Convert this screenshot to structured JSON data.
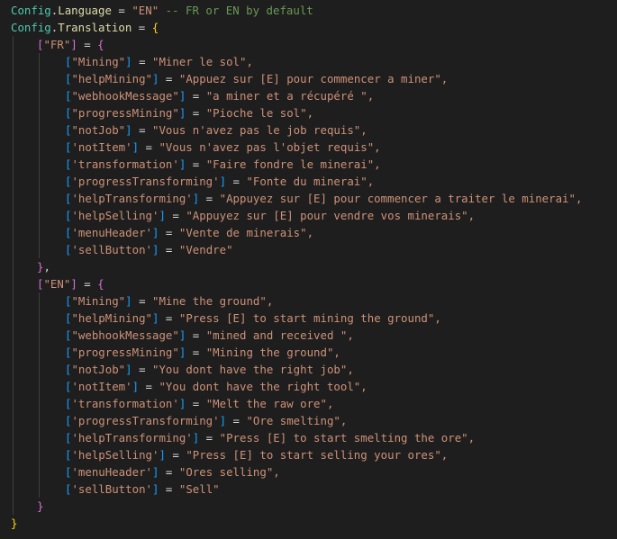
{
  "editor": {
    "config_name": "Config",
    "language_prop": "Language",
    "language_value": "\"EN\"",
    "language_comment": "-- FR or EN by default",
    "translation_prop": "Translation",
    "groups": [
      {
        "key": "\"FR\"",
        "entries": [
          {
            "key": "\"Mining\"",
            "value": "\"Miner le sol\","
          },
          {
            "key": "\"helpMining\"",
            "value": "\"Appuez sur [E] pour commencer a miner\","
          },
          {
            "key": "\"webhookMessage\"",
            "value": "\"a miner et a récupéré \","
          },
          {
            "key": "\"progressMining\"",
            "value": "\"Pioche le sol\","
          },
          {
            "key": "\"notJob\"",
            "value": "\"Vous n'avez pas le job requis\","
          },
          {
            "key": "'notItem'",
            "value": "\"Vous n'avez pas l'objet requis\","
          },
          {
            "key": "'transformation'",
            "value": "\"Faire fondre le minerai\","
          },
          {
            "key": "'progressTransforming'",
            "value": "\"Fonte du minerai\","
          },
          {
            "key": "'helpTransforming'",
            "value": "\"Appuyez sur [E] pour commencer a traiter le minerai\","
          },
          {
            "key": "'helpSelling'",
            "value": "\"Appuyez sur [E] pour vendre vos minerais\","
          },
          {
            "key": "'menuHeader'",
            "value": "\"Vente de minerais\","
          },
          {
            "key": "'sellButton'",
            "value": "\"Vendre\""
          }
        ]
      },
      {
        "key": "\"EN\"",
        "entries": [
          {
            "key": "\"Mining\"",
            "value": "\"Mine the ground\","
          },
          {
            "key": "\"helpMining\"",
            "value": "\"Press [E] to start mining the ground\","
          },
          {
            "key": "\"webhookMessage\"",
            "value": "\"mined and received \","
          },
          {
            "key": "\"progressMining\"",
            "value": "\"Mining the ground\","
          },
          {
            "key": "\"notJob\"",
            "value": "\"You dont have the right job\","
          },
          {
            "key": "'notItem'",
            "value": "\"You dont have the right tool\","
          },
          {
            "key": "'transformation'",
            "value": "\"Melt the raw ore\","
          },
          {
            "key": "'progressTransforming'",
            "value": "\"Ore smelting\","
          },
          {
            "key": "'helpTransforming'",
            "value": "\"Press [E] to start smelting the ore\","
          },
          {
            "key": "'helpSelling'",
            "value": "\"Press [E] to start selling your ores\","
          },
          {
            "key": "'menuHeader'",
            "value": "\"Ores selling\","
          },
          {
            "key": "'sellButton'",
            "value": "\"Sell\""
          }
        ]
      }
    ]
  }
}
